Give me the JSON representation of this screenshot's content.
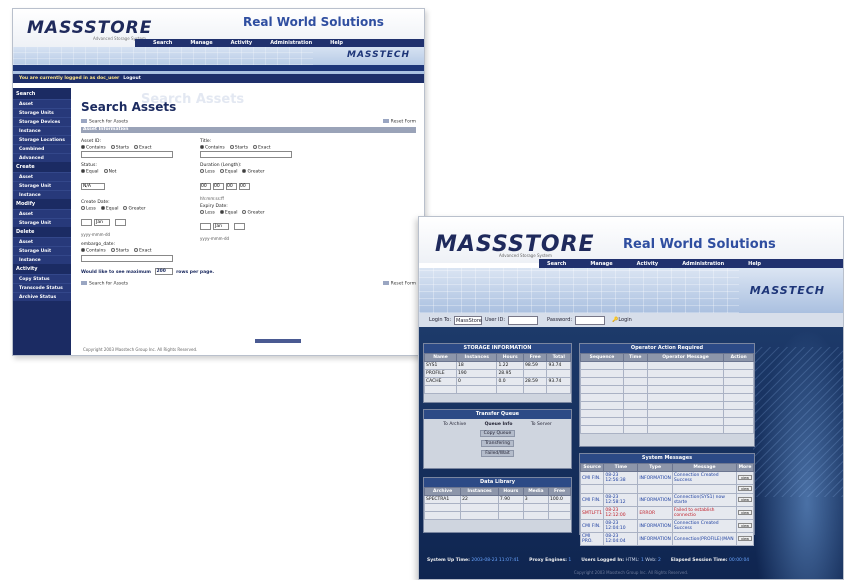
{
  "windowA": {
    "logo": "MASSSTORE",
    "logo_sub": "Advanced Storage System",
    "tagline": "Real World Solutions",
    "nav": [
      "Search",
      "Manage",
      "Activity",
      "Administration",
      "Help"
    ],
    "brand2": "MASSTECH",
    "login_status": "You are currently logged in as doc_user",
    "logout": "Logout",
    "sidebar": [
      {
        "group": "Search",
        "items": [
          "Asset",
          "Storage Units",
          "Storage Devices",
          "Instance",
          "Storage Locations",
          "Combined",
          "Advanced"
        ]
      },
      {
        "group": "Create",
        "items": [
          "Asset",
          "Storage Unit",
          "Instance"
        ]
      },
      {
        "group": "Modify",
        "items": [
          "Asset",
          "Storage Unit"
        ]
      },
      {
        "group": "Delete",
        "items": [
          "Asset",
          "Storage Unit",
          "Instance"
        ]
      },
      {
        "group": "Activity",
        "items": [
          "Copy Status",
          "Transcode Status",
          "Archive Status"
        ]
      }
    ],
    "page_title_ghost": "Search Assets",
    "page_title": "Search Assets",
    "search_link": "Search for Assets",
    "reset_link": "Reset Form",
    "section": "Asset Information",
    "fields": {
      "asset_id": "Asset ID:",
      "title": "Title:",
      "status": "Status:",
      "duration": "Duration (Length):",
      "create_date": "Create Date:",
      "expiry_date": "Expiry Date:",
      "embargo_date": "embargo_date:"
    },
    "opts_match": [
      "Contains",
      "Starts",
      "Exact"
    ],
    "opts_equal": [
      "Equal",
      "Not"
    ],
    "opts_cmp": [
      "Less",
      "Equal",
      "Greater"
    ],
    "status_value": "N/A",
    "duration_values": [
      "00",
      "00",
      "00",
      "00"
    ],
    "duration_hint": "hh:mm:ss:ff",
    "date_month": "Jan",
    "date_hint": "yyyy-mmm-dd",
    "max_text": "Would like to see maximum",
    "max_value": "200",
    "max_suffix": "rows per page.",
    "copyright": "Copyright 2003 Masstech Group Inc. All Rights Reserved."
  },
  "windowB": {
    "logo": "MASSSTORE",
    "logo_sub": "Advanced Storage System",
    "tagline": "Real World Solutions",
    "nav": [
      "Search",
      "Manage",
      "Activity",
      "Administration",
      "Help"
    ],
    "brand2": "MASSTECH",
    "login": {
      "login_to_label": "Login To:",
      "login_to_value": "MassStore",
      "user_id_label": "User ID:",
      "password_label": "Password:",
      "login_button": "Login"
    },
    "storage": {
      "title": "STORAGE INFORMATION",
      "headers": [
        "Name",
        "Instances",
        "Hours",
        "Free",
        "Total"
      ],
      "rows": [
        [
          "SYS1",
          "18",
          "1.22",
          "98.59",
          "93.74"
        ],
        [
          "PROFILE",
          "190",
          "28.95",
          "",
          ""
        ],
        [
          "CACHE",
          "0",
          "0.0",
          "28.59",
          "93.74"
        ]
      ]
    },
    "operator": {
      "title": "Operator Action Required",
      "headers": [
        "Sequence",
        "Time",
        "Operator Message",
        "Action"
      ]
    },
    "transfer": {
      "title": "Transfer Queue",
      "to_archive": "To Archive",
      "queue_info": "Queue Info",
      "to_server": "To Server",
      "statuses": [
        "Copy Queue",
        "Transfering",
        "Failed/Wait"
      ]
    },
    "library": {
      "title": "Data Library",
      "headers": [
        "Archive",
        "Instances",
        "Hours",
        "Media",
        "Free"
      ],
      "rows": [
        [
          "SPECTRA1",
          "22",
          "7.90",
          "3",
          "100.0"
        ]
      ]
    },
    "messages": {
      "title": "System Messages",
      "headers": [
        "Source",
        "Time",
        "Type",
        "Message",
        "More"
      ],
      "rows": [
        [
          "CMI FIN.",
          "08-23 12:56:38",
          "INFORMATION",
          "Connection Created Success",
          "view"
        ],
        [
          "",
          "",
          "",
          "",
          "view"
        ],
        [
          "CMI FIN.",
          "08-23 12:58:12",
          "INFORMATION",
          "Connection(SYS1) now starte",
          "view"
        ],
        [
          "SMTLFT1",
          "08-23 12:12:00",
          "ERROR",
          "Failed to establish connectio",
          "view"
        ],
        [
          "CMI FIN.",
          "08-23 12:04:10",
          "INFORMATION",
          "Connection Created Success",
          "view"
        ],
        [
          "CMI PRO.",
          "08-23 12:04:04",
          "INFORMATION",
          "Connection(PROFILE)(MAN",
          "view"
        ]
      ],
      "row_colors": [
        "blue",
        "blue",
        "blue",
        "red",
        "blue",
        "blue"
      ]
    },
    "status": {
      "system_up_label": "System Up Time:",
      "system_up_value": "2003-08-23 11:07:41",
      "proxy_label": "Proxy Engines:",
      "proxy_value": "1",
      "users_label": "Users Logged In:",
      "users_html_label": "HTML:",
      "users_html_value": "1",
      "users_web_label": "Web:",
      "users_web_value": "2",
      "elapsed_label": "Elapsed Session Time:",
      "elapsed_value": "00:00:04"
    },
    "copyright": "Copyright 2003 Masstech Group Inc. All Rights Reserved."
  }
}
